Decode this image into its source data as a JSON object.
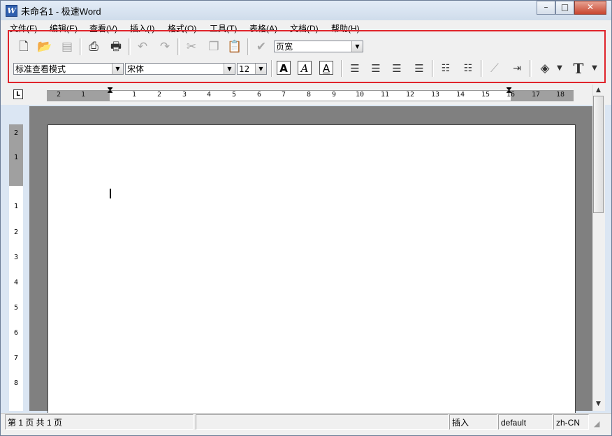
{
  "window": {
    "title": "未命名1 - 极速Word",
    "app_icon_letter": "W",
    "minimize": "–",
    "maximize": "□",
    "close": "✕"
  },
  "menu": [
    "文件(F)",
    "编辑(E)",
    "查看(V)",
    "插入(I)",
    "格式(O)",
    "工具(T)",
    "表格(A)",
    "文档(D)",
    "帮助(H)"
  ],
  "toolbar": {
    "zoom_value": "页宽",
    "style_value": "标准查看模式",
    "font_value": "宋体",
    "size_value": "12",
    "bold_label": "A",
    "italic_label": "A",
    "underline_label": "A",
    "text_label": "T",
    "icons": [
      "new-icon",
      "open-icon",
      "save-icon",
      "print-preview-icon",
      "print-icon",
      "undo-icon",
      "redo-icon",
      "cut-icon",
      "copy-icon",
      "paste-icon",
      "spellcheck-icon",
      "align-left-icon",
      "align-center-icon",
      "align-right-icon",
      "justify-icon",
      "numbered-list-icon",
      "bullet-list-icon",
      "insert-line-icon",
      "indent-icon",
      "fill-color-icon",
      "text-color-icon"
    ]
  },
  "ruler": {
    "corner": "L",
    "h_labels": [
      "2",
      "1",
      "1",
      "2",
      "3",
      "4",
      "5",
      "6",
      "7",
      "8",
      "9",
      "10",
      "11",
      "12",
      "13",
      "14",
      "15",
      "16",
      "17",
      "18"
    ],
    "v_labels": [
      "2",
      "1",
      "1",
      "2",
      "3",
      "4",
      "5",
      "6",
      "7",
      "8"
    ]
  },
  "status": {
    "page_info": "第 1 页  共 1 页",
    "mode": "插入",
    "style": "default",
    "language": "zh-CN"
  }
}
